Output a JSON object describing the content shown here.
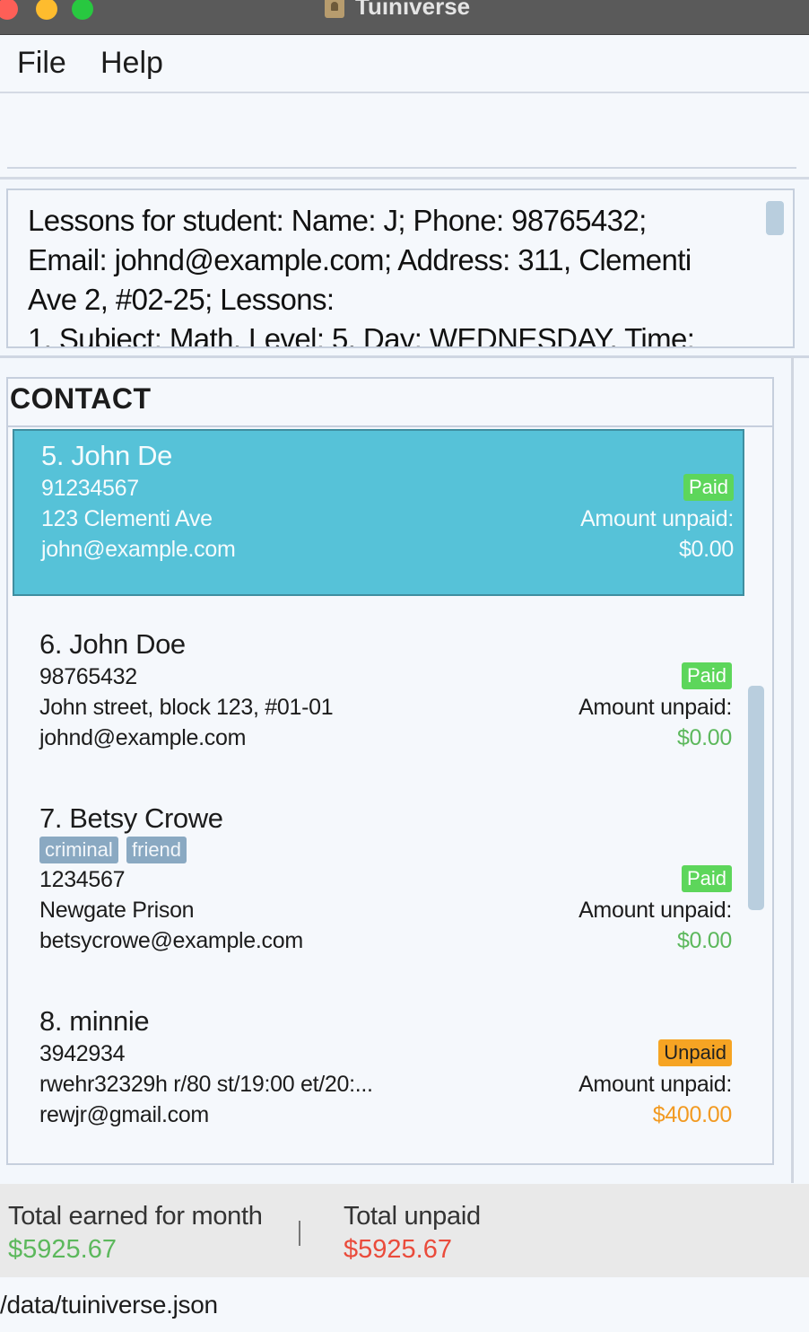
{
  "window": {
    "title": "Tuiniverse"
  },
  "menu": {
    "items": [
      "File",
      "Help"
    ]
  },
  "command": {
    "value": "",
    "placeholder": ""
  },
  "result": {
    "text": "Lessons for student: Name: J; Phone: 98765432;\nEmail: johnd@example.com; Address: 311, Clementi\nAve 2, #02-25; Lessons:\n1. Subject: Math, Level: 5, Day: WEDNESDAY, Time:"
  },
  "contacts": {
    "title": "CONTACT",
    "list": [
      {
        "name": "5. John De",
        "phone": "91234567",
        "address": "123 Clementi Ave",
        "email": "john@example.com",
        "status": "Paid",
        "amount_label": "Amount unpaid:",
        "amount": "$0.00",
        "tags": []
      },
      {
        "name": "6. John Doe",
        "phone": "98765432",
        "address": "John street, block 123, #01-01",
        "email": "johnd@example.com",
        "status": "Paid",
        "amount_label": "Amount unpaid:",
        "amount": "$0.00",
        "tags": []
      },
      {
        "name": "7. Betsy Crowe",
        "phone": "1234567",
        "address": "Newgate Prison",
        "email": "betsycrowe@example.com",
        "status": "Paid",
        "amount_label": "Amount unpaid:",
        "amount": "$0.00",
        "tags": [
          "criminal",
          "friend"
        ]
      },
      {
        "name": "8. minnie",
        "phone": "3942934",
        "address": "rwehr32329h r/80 st/19:00 et/20:...",
        "email": "rewjr@gmail.com",
        "status": "Unpaid",
        "amount_label": "Amount unpaid:",
        "amount": "$400.00",
        "tags": []
      }
    ]
  },
  "summary": {
    "earned_label": "Total earned for month",
    "earned_value": "$5925.67",
    "unpaid_label": "Total unpaid",
    "unpaid_value": "$5925.67"
  },
  "status": {
    "path": "/data/tuiniverse.json"
  },
  "colors": {
    "selected_card": "#56c2d8",
    "paid_badge": "#5dd65b",
    "unpaid_badge": "#f6a423",
    "earned": "#5cb85c",
    "unpaid_total": "#ea4b3b",
    "tag": "#8aa9c2"
  }
}
